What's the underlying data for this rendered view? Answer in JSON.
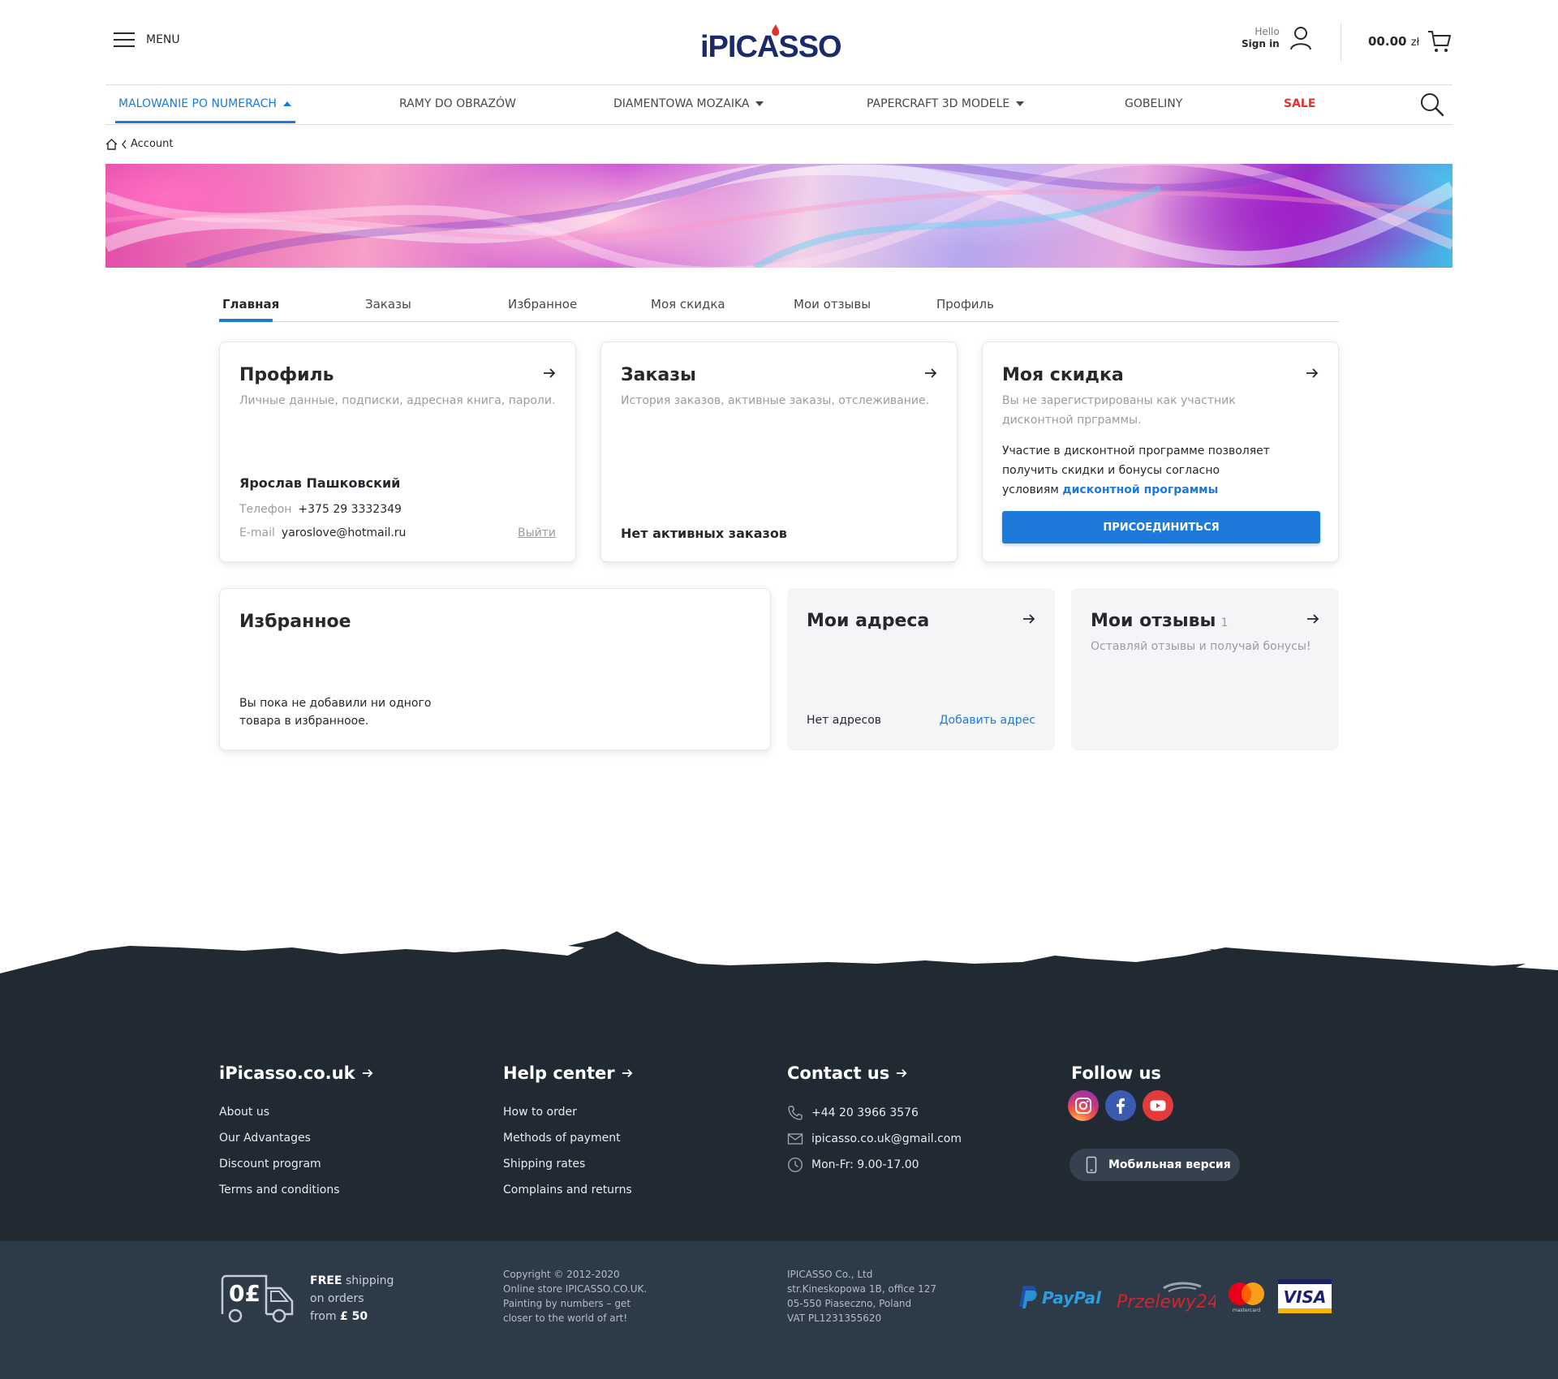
{
  "header": {
    "menu_label": "MENU",
    "logo_text": "iPICASSO",
    "hello": "Hello",
    "sign_in": "Sign in",
    "cart_amount": "00.00",
    "cart_currency": "zł"
  },
  "nav": {
    "items": [
      {
        "label": "MALOWANIE PO NUMERACH",
        "dropdown": true,
        "active": true
      },
      {
        "label": "RAMY DO OBRAZÓW",
        "dropdown": false
      },
      {
        "label": "DIAMENTOWA MOZAIKA",
        "dropdown": true
      },
      {
        "label": "PAPERCRAFT 3D MODELE",
        "dropdown": true
      },
      {
        "label": "GOBELINY",
        "dropdown": false
      },
      {
        "label": "SALE",
        "dropdown": false,
        "color": "#e2322c"
      }
    ]
  },
  "breadcrumb": {
    "label": "Account"
  },
  "tabs": [
    "Главная",
    "Заказы",
    "Избранное",
    "Моя скидка",
    "Мои отзывы",
    "Профиль"
  ],
  "cards": {
    "profile": {
      "title": "Профиль",
      "subtitle": "Личные данные, подписки, адресная книга, пароли.",
      "name": "Ярослав Пашковский",
      "phone_label": "Телефон",
      "phone": "+375 29 3332349",
      "email_label": "E-mail",
      "email": "yaroslove@hotmail.ru",
      "logout": "Выйти"
    },
    "orders": {
      "title": "Заказы",
      "subtitle": "История заказов, активные заказы, отслеживание.",
      "empty": "Нет активных заказов"
    },
    "discount": {
      "title": "Моя скидка",
      "subtitle": "Вы не зарегистрированы как участник дисконтной прграммы.",
      "text": "Участие в дисконтной программе позволяет получить скидки и бонусы согласно условиям",
      "link": "дисконтной программы",
      "button": "ПРИСОЕДИНИТЬСЯ"
    },
    "favorites": {
      "title": "Избранное",
      "text": "Вы пока не добавили ни одного товара в избранноое."
    },
    "addresses": {
      "title": "Мои адреса",
      "empty": "Нет адресов",
      "add": "Добавить адрес"
    },
    "reviews": {
      "title": "Мои отзывы",
      "count": "1",
      "subtitle": "Оставляй отзывы и получай бонусы!"
    }
  },
  "footer": {
    "site": {
      "title": "iPicasso.co.uk",
      "links": [
        "About us",
        "Our Advantages",
        "Discount program",
        "Terms and conditions"
      ]
    },
    "help": {
      "title": "Help center",
      "links": [
        "How to order",
        "Methods of payment",
        "Shipping rates",
        "Complains and returns"
      ]
    },
    "contact": {
      "title": "Contact us",
      "phone": "+44 20 3966 3576",
      "email": "ipicasso.co.uk@gmail.com",
      "hours": "Mon-Fr: 9.00-17.00"
    },
    "follow": {
      "title": "Follow us",
      "icons": [
        "instagram-icon",
        "facebook-icon",
        "youtube-icon"
      ],
      "mobile_btn": "Мобильная версия"
    },
    "shipping": {
      "badge": "0£",
      "line1_bold": "FREE",
      "line1": "shipping",
      "line2": "on orders",
      "line3": "from",
      "line3_bold": "£ 50"
    },
    "copyright": [
      "Copyright © 2012-2020",
      "Online store IPICASSO.CO.UK.",
      "Painting by numbers – get",
      "closer to the world of art!"
    ],
    "company": [
      "IPICASSO Co., Ltd",
      "str.Kineskopowa 1B, office 127",
      "05-550 Piaseczno, Poland",
      "VAT PL1231355620"
    ],
    "payments": [
      "PayPal",
      "Przelewy24",
      "mastercard",
      "VISA"
    ]
  },
  "colors": {
    "accent": "#1e7ad8",
    "sale": "#e2322c",
    "footer_dark": "#212a33",
    "footer_bottom": "#2d3a48"
  }
}
